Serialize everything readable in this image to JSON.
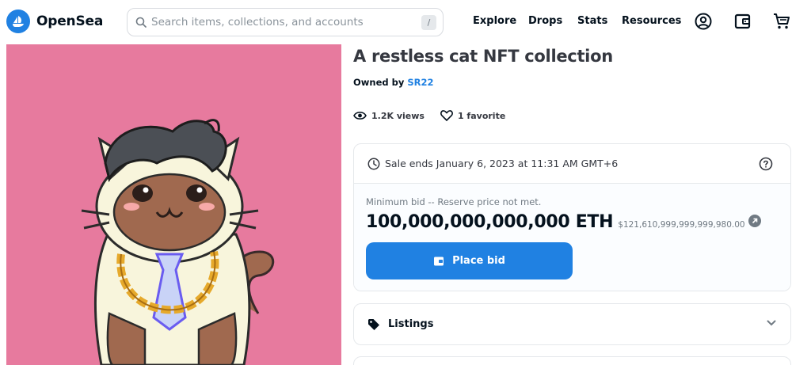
{
  "brand": {
    "name": "OpenSea",
    "color": "#2081e2"
  },
  "search": {
    "placeholder": "Search items, collections, and accounts",
    "shortcut": "/"
  },
  "nav": {
    "explore": "Explore",
    "drops": "Drops",
    "stats": "Stats",
    "resources": "Resources"
  },
  "header_icons": [
    "account-icon",
    "wallet-icon",
    "cart-icon"
  ],
  "item": {
    "title": "A restless cat NFT collection",
    "owned_prefix": "Owned by ",
    "owner": "SR22",
    "views": "1.2K views",
    "favorites": "1 favorite"
  },
  "sale": {
    "ends": "Sale ends January 6, 2023 at 11:31 AM GMT+6",
    "min_bid_note": "Minimum bid -- Reserve price not met.",
    "price": "100,000,000,000,000 ETH",
    "usd": "$121,610,999,999,999,980.00",
    "place_bid": "Place bid"
  },
  "listings": {
    "label": "Listings"
  },
  "colors": {
    "art_background": "#e77a9e",
    "primary": "#2081e2",
    "text": "#04111d"
  }
}
